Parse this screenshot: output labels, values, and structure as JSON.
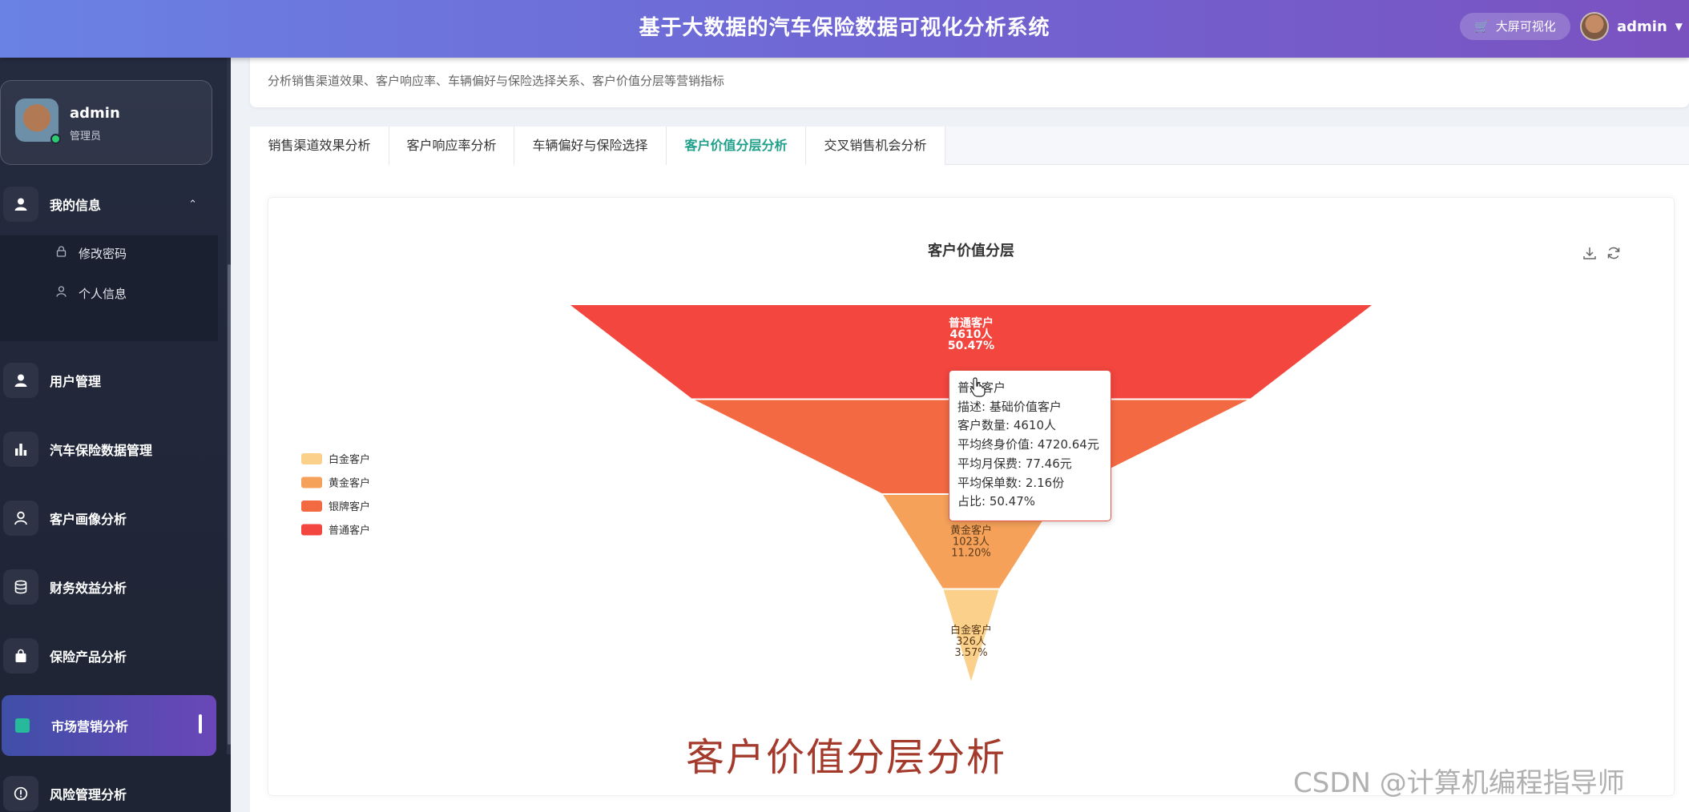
{
  "header": {
    "title": "基于大数据的汽车保险数据可视化分析系统",
    "bigscreen_label": "大屏可视化",
    "username": "admin"
  },
  "sidebar": {
    "user": {
      "name": "admin",
      "role": "管理员"
    },
    "my_info": "我的信息",
    "sub_items": [
      "修改密码",
      "个人信息"
    ],
    "items": [
      "用户管理",
      "汽车保险数据管理",
      "客户画像分析",
      "财务效益分析",
      "保险产品分析",
      "市场营销分析",
      "风险管理分析"
    ],
    "active_index": 5
  },
  "page": {
    "description": "分析销售渠道效果、客户响应率、车辆偏好与保险选择关系、客户价值分层等营销指标",
    "tabs": [
      "销售渠道效果分析",
      "客户响应率分析",
      "车辆偏好与保险选择",
      "客户价值分层分析",
      "交叉销售机会分析"
    ],
    "active_tab": 3,
    "caption": "客户价值分层分析"
  },
  "chart_data": {
    "type": "funnel",
    "title": "客户价值分层",
    "legend": [
      "白金客户",
      "黄金客户",
      "银牌客户",
      "普通客户"
    ],
    "legend_position": "left",
    "series": [
      {
        "name": "普通客户",
        "value": 4610,
        "label": "4610人",
        "percent": "50.47%",
        "color": "#f2463f"
      },
      {
        "name": "银牌客户",
        "value": 3176,
        "label": "",
        "percent": "",
        "color": "#f36a42"
      },
      {
        "name": "黄金客户",
        "value": 1023,
        "label": "1023人",
        "percent": "11.20%",
        "color": "#f5a15a"
      },
      {
        "name": "白金客户",
        "value": 326,
        "label": "326人",
        "percent": "3.57%",
        "color": "#fbd08a"
      }
    ],
    "legend_colors": [
      "#fbd08a",
      "#f5a15a",
      "#f36a42",
      "#f2463f"
    ],
    "tooltip": {
      "title": "普通客户",
      "lines": [
        "描述: 基础价值客户",
        "客户数量: 4610人",
        "平均终身价值: 4720.64元",
        "平均月保费: 77.46元",
        "平均保单数: 2.16份",
        "占比: 50.47%"
      ]
    }
  },
  "watermark": "CSDN @计算机编程指导师"
}
